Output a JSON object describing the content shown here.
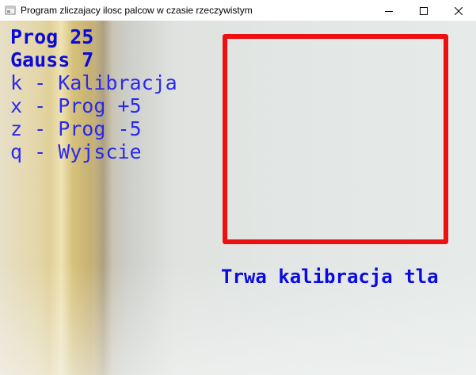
{
  "window": {
    "title": "Program zliczajacy ilosc palcow w czasie rzeczywistym",
    "icons": {
      "app": "camera-window-icon",
      "minimize": "minimize-icon",
      "maximize": "maximize-icon",
      "close": "close-icon"
    }
  },
  "overlay": {
    "threshold": "Prog 25",
    "gauss": "Gauss 7",
    "keys": [
      "k - Kalibracja",
      "x - Prog +5",
      "z - Prog -5",
      "q - Wyjscie"
    ],
    "status": "Trwa kalibracja tla"
  },
  "colors": {
    "overlay_text": "#1a1aff",
    "roi_border": "#ee1010",
    "status_text": "#0a0ae6"
  }
}
